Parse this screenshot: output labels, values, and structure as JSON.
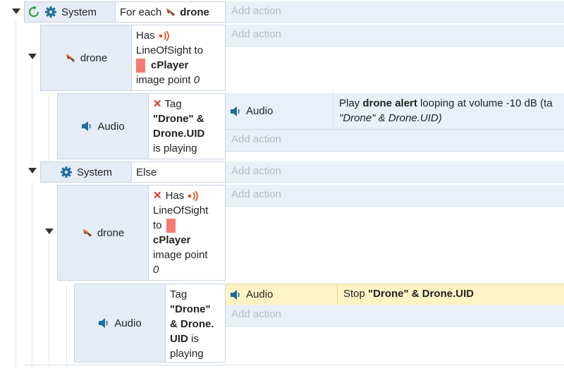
{
  "events": {
    "foreach": {
      "object": "System",
      "text_prefix": "For each",
      "target": "drone",
      "add_action": "Add action"
    },
    "sub1": {
      "object": "drone",
      "cond_word1": "Has",
      "cond_word2": "LineOfSight to",
      "target": "cPlayer",
      "tail_word": "image point",
      "tail_num": "0",
      "add_action": "Add action"
    },
    "sub1_audio": {
      "object": "Audio",
      "cond_word1": "Tag",
      "tag_name": "\"Drone\" &",
      "uid": "Drone.UID",
      "tail": "is playing",
      "action": {
        "object": "Audio",
        "play": "Play",
        "sound": "drone alert",
        "rest": "looping at volume -10 dB (ta",
        "line2": "\"Drone\" & Drone.UID)"
      },
      "add_action": "Add action"
    },
    "else": {
      "object": "System",
      "text": "Else",
      "add_action": "Add action"
    },
    "sub2": {
      "object": "drone",
      "cond_word1": "Has",
      "cond_word2": "LineOfSight",
      "cond_word3": "to",
      "target": "cPlayer",
      "tail_word": "image point",
      "tail_num": "0",
      "add_action": "Add action"
    },
    "sub2_audio": {
      "object": "Audio",
      "cond_word1": "Tag",
      "tag_name": "\"Drone\"",
      "uid1": "& Drone.",
      "uid2": "UID",
      "tail1": "is",
      "tail2": "playing",
      "action": {
        "object": "Audio",
        "stop": "Stop",
        "target": "\"Drone\" & Drone.UID"
      },
      "add_action": "Add action"
    }
  },
  "colors": {
    "selected_action": "#fff3c6",
    "condition_object": "#e6ecf5",
    "accent_icon": "#1c6e9c",
    "invert_x": "#e03030"
  }
}
